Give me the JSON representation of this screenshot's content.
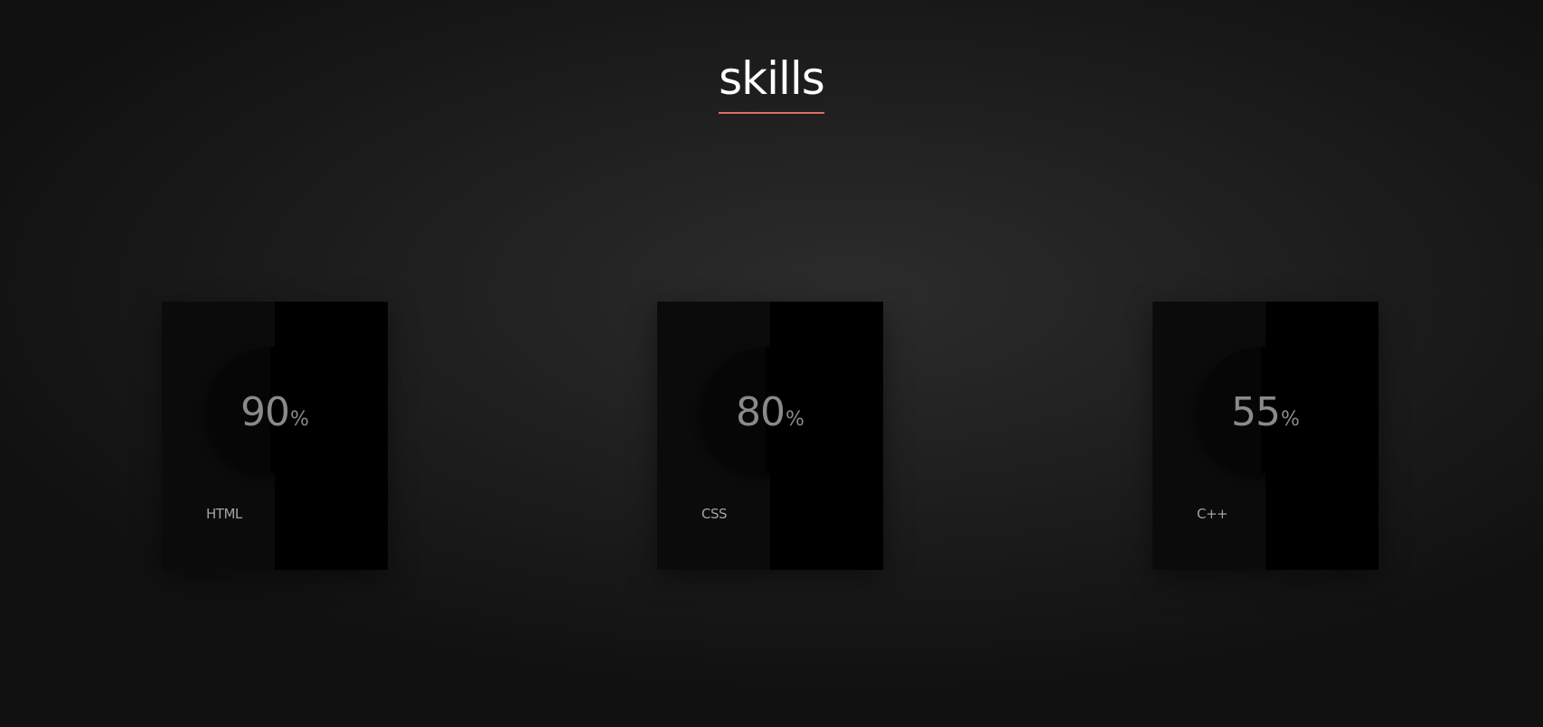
{
  "section": {
    "title": "skills",
    "accent_color": "#e36a6a"
  },
  "skills": [
    {
      "name": "HTML",
      "value": "90",
      "unit": "%",
      "percent": 90
    },
    {
      "name": "CSS",
      "value": "80",
      "unit": "%",
      "percent": 80
    },
    {
      "name": "C++",
      "value": "55",
      "unit": "%",
      "percent": 55
    }
  ]
}
